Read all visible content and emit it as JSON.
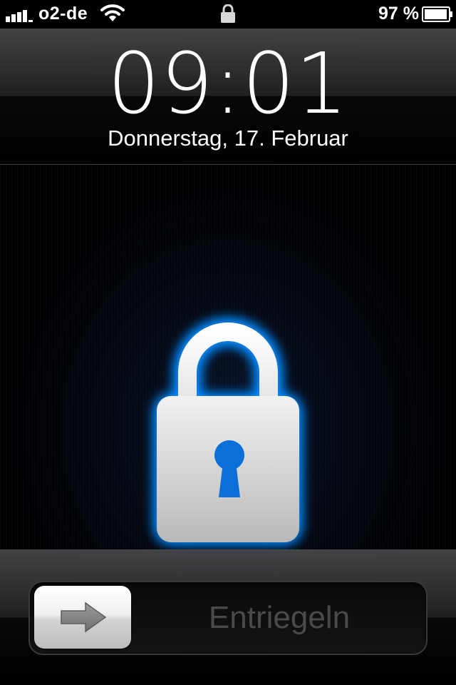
{
  "status_bar": {
    "carrier": "o2-de",
    "battery_percent": "97 %",
    "battery_level": 0.97,
    "signal_bars": 4
  },
  "clock": {
    "time": "09:01",
    "date": "Donnerstag, 17. Februar"
  },
  "slider": {
    "label": "Entriegeln"
  },
  "icons": {
    "signal": "signal-bars-icon",
    "wifi": "wifi-icon",
    "status_lock": "lock-icon",
    "battery": "battery-icon",
    "padlock": "padlock-icon",
    "arrow": "arrow-right-icon"
  },
  "colors": {
    "lock_glow": "#0a8cff",
    "keyhole": "#0a6fd8",
    "slider_text": "#4a4a4d"
  }
}
